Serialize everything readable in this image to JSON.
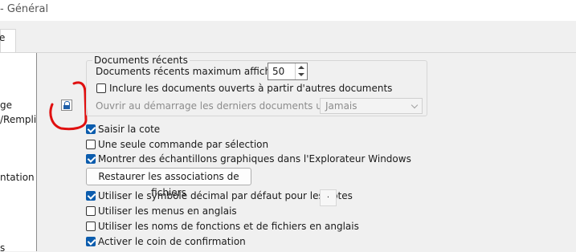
{
  "window": {
    "title": "- Général"
  },
  "tabs": [
    {
      "label": "e"
    }
  ],
  "left_tree": {
    "items": [
      "ge",
      "/Rempli",
      "ntation",
      "s"
    ]
  },
  "recent_docs": {
    "group_title": "Documents récents",
    "max_label": "Documents récents maximum affichés :",
    "max_value": "50",
    "include_label": "Inclure les documents ouverts à partir d'autres documents",
    "include_checked": false,
    "open_at_start_label": "Ouvrir au démarrage les derniers documents utilisés:",
    "open_at_start_value": "Jamais"
  },
  "options": [
    {
      "label": "Saisir la cote",
      "checked": true
    },
    {
      "label": "Une seule commande par sélection",
      "checked": false
    },
    {
      "label": "Montrer des échantillons graphiques dans l'Explorateur Windows",
      "checked": true
    }
  ],
  "restore_button": "Restaurer les associations de fichiers",
  "options2": [
    {
      "label": "Utiliser le symbole décimal par défaut pour les cotes",
      "checked": true,
      "value": "."
    },
    {
      "label": "Utiliser les menus en anglais",
      "checked": false
    },
    {
      "label": "Utiliser les noms de fonctions et de fichiers en anglais",
      "checked": false
    },
    {
      "label": "Activer le coin de confirmation",
      "checked": true
    }
  ],
  "icons": {
    "lock": "lock-icon"
  },
  "colors": {
    "accent": "#0b5cad",
    "annotation": "#e01010"
  }
}
